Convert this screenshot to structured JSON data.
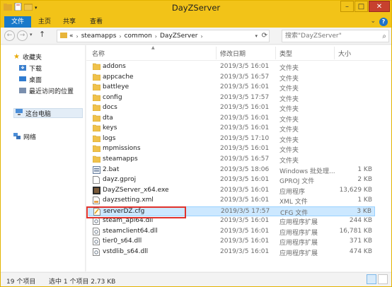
{
  "window": {
    "title": "DayZServer"
  },
  "ribbon": {
    "tabs": [
      {
        "label": "文件"
      },
      {
        "label": "主页"
      },
      {
        "label": "共享"
      },
      {
        "label": "查看"
      }
    ]
  },
  "address": {
    "overflow": "«",
    "crumbs": [
      "steamapps",
      "common",
      "DayZServer"
    ],
    "search_placeholder": "搜索\"DayZServer\""
  },
  "nav": {
    "favorites_label": "收藏夹",
    "favorites": [
      "下载",
      "桌面",
      "最近访问的位置"
    ],
    "this_pc": "这台电脑",
    "network": "网络"
  },
  "columns": {
    "name": "名称",
    "date": "修改日期",
    "type": "类型",
    "size": "大小"
  },
  "files": [
    {
      "name": "addons",
      "date": "2019/3/5 16:01",
      "type": "文件夹",
      "size": "",
      "icon": "folder"
    },
    {
      "name": "appcache",
      "date": "2019/3/5 16:57",
      "type": "文件夹",
      "size": "",
      "icon": "folder"
    },
    {
      "name": "battleye",
      "date": "2019/3/5 16:01",
      "type": "文件夹",
      "size": "",
      "icon": "folder"
    },
    {
      "name": "config",
      "date": "2019/3/5 17:57",
      "type": "文件夹",
      "size": "",
      "icon": "folder"
    },
    {
      "name": "docs",
      "date": "2019/3/5 16:01",
      "type": "文件夹",
      "size": "",
      "icon": "folder"
    },
    {
      "name": "dta",
      "date": "2019/3/5 16:01",
      "type": "文件夹",
      "size": "",
      "icon": "folder"
    },
    {
      "name": "keys",
      "date": "2019/3/5 16:01",
      "type": "文件夹",
      "size": "",
      "icon": "folder"
    },
    {
      "name": "logs",
      "date": "2019/3/5 17:10",
      "type": "文件夹",
      "size": "",
      "icon": "folder"
    },
    {
      "name": "mpmissions",
      "date": "2019/3/5 16:01",
      "type": "文件夹",
      "size": "",
      "icon": "folder"
    },
    {
      "name": "steamapps",
      "date": "2019/3/5 16:57",
      "type": "文件夹",
      "size": "",
      "icon": "folder"
    },
    {
      "name": "2.bat",
      "date": "2019/3/5 18:06",
      "type": "Windows 批处理...",
      "size": "1 KB",
      "icon": "bat"
    },
    {
      "name": "dayz.gproj",
      "date": "2019/3/5 16:01",
      "type": "GPROJ 文件",
      "size": "2 KB",
      "icon": "doc"
    },
    {
      "name": "DayZServer_x64.exe",
      "date": "2019/3/5 16:01",
      "type": "应用程序",
      "size": "13,629 KB",
      "icon": "exe"
    },
    {
      "name": "dayzsetting.xml",
      "date": "2019/3/5 16:01",
      "type": "XML 文件",
      "size": "1 KB",
      "icon": "xml"
    },
    {
      "name": "serverDZ.cfg",
      "date": "2019/3/5 17:57",
      "type": "CFG 文件",
      "size": "3 KB",
      "icon": "cfg",
      "selected": true
    },
    {
      "name": "steam_api64.dll",
      "date": "2019/3/5 16:01",
      "type": "应用程序扩展",
      "size": "244 KB",
      "icon": "dll"
    },
    {
      "name": "steamclient64.dll",
      "date": "2019/3/5 16:01",
      "type": "应用程序扩展",
      "size": "16,781 KB",
      "icon": "dll"
    },
    {
      "name": "tier0_s64.dll",
      "date": "2019/3/5 16:01",
      "type": "应用程序扩展",
      "size": "371 KB",
      "icon": "dll"
    },
    {
      "name": "vstdlib_s64.dll",
      "date": "2019/3/5 16:01",
      "type": "应用程序扩展",
      "size": "474 KB",
      "icon": "dll"
    }
  ],
  "status": {
    "count": "19 个项目",
    "selection": "选中 1 个项目  2.73 KB"
  },
  "colors": {
    "titlebar": "#f2c318",
    "file_tab": "#1979ca",
    "selected_row": "#cce8ff",
    "highlight_box": "#e0322c"
  }
}
